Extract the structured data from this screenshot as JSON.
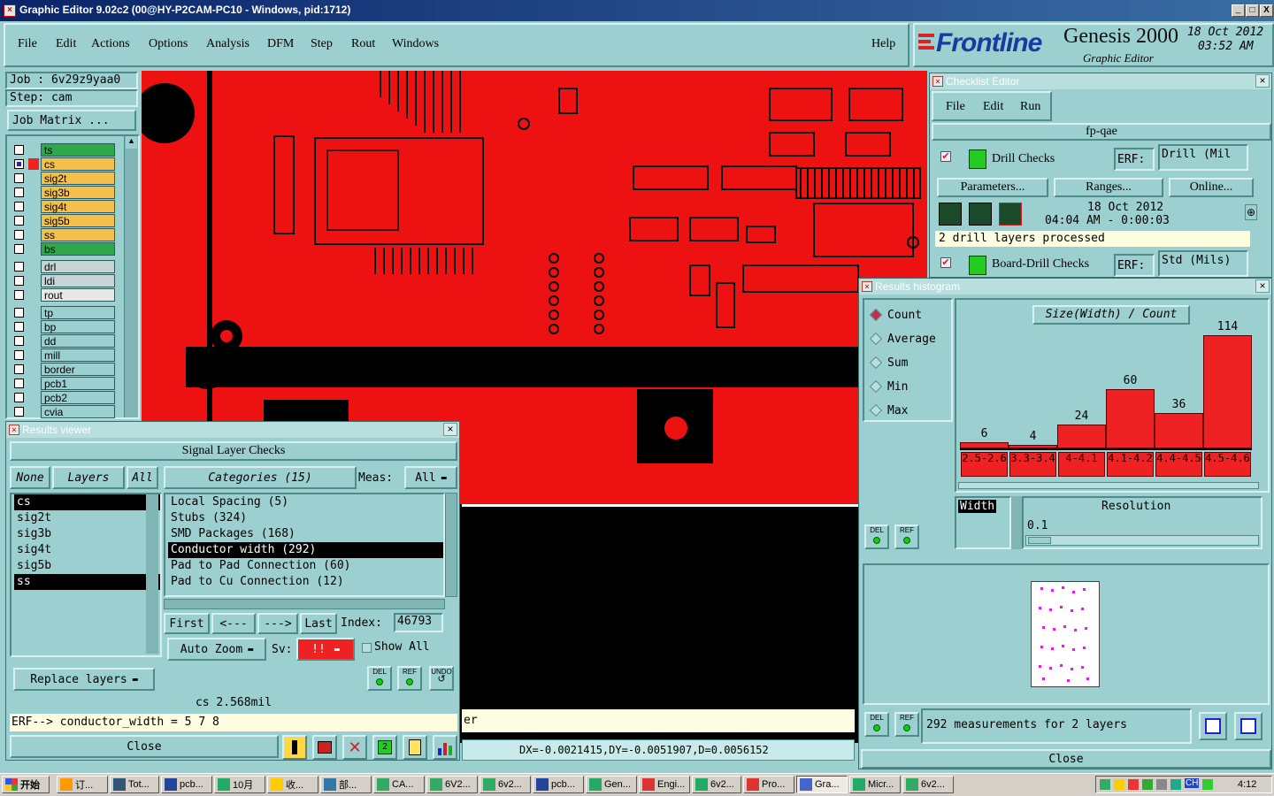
{
  "window": {
    "title": "Graphic Editor 9.02c2 (00@HY-P2CAM-PC10 - Windows, pid:1712)",
    "controls": [
      "_",
      "□",
      "X"
    ]
  },
  "menu": {
    "items": [
      "File",
      "Edit",
      "Actions",
      "Options",
      "Analysis",
      "DFM",
      "Step",
      "Rout",
      "Windows"
    ],
    "help": "Help"
  },
  "branding": {
    "logo": "Frontline",
    "product": "Genesis 2000",
    "subtitle": "Graphic Editor",
    "date": "18 Oct 2012",
    "time": "03:52 AM"
  },
  "job": {
    "job_label": "Job : 6v29z9yaa0",
    "step_label": "Step: cam",
    "matrix_button": "Job Matrix ..."
  },
  "layers": {
    "group1": [
      {
        "name": "ts",
        "color": "#2fa84a"
      },
      {
        "name": "cs",
        "color": "#f5c04a",
        "active": true
      },
      {
        "name": "sig2t",
        "color": "#f5c04a"
      },
      {
        "name": "sig3b",
        "color": "#f5c04a"
      },
      {
        "name": "sig4t",
        "color": "#f5c04a"
      },
      {
        "name": "sig5b",
        "color": "#f5c04a"
      },
      {
        "name": "ss",
        "color": "#f5c04a"
      },
      {
        "name": "bs",
        "color": "#2fa84a"
      }
    ],
    "group2": [
      {
        "name": "drl",
        "color": "#c8d4d4"
      },
      {
        "name": "ldi",
        "color": "#c8d4d4"
      },
      {
        "name": "rout",
        "color": "#e8e8e8"
      }
    ],
    "group3": [
      {
        "name": "tp"
      },
      {
        "name": "bp"
      },
      {
        "name": "dd"
      },
      {
        "name": "mill"
      },
      {
        "name": "border"
      },
      {
        "name": "pcb1"
      },
      {
        "name": "pcb2"
      },
      {
        "name": "cvia"
      }
    ]
  },
  "results_viewer": {
    "title": "Results viewer",
    "header": "Signal Layer Checks",
    "none_btn": "None",
    "layers_btn": "Layers",
    "all_btn": "All",
    "categories_btn": "Categories (15)",
    "meas_label": "Meas:",
    "meas_value": "All",
    "layer_list": [
      "cs",
      "sig2t",
      "sig3b",
      "sig4t",
      "sig5b",
      "ss"
    ],
    "categories": [
      "Local Spacing (5)",
      "Stubs (324)",
      "SMD Packages (168)",
      "Conductor width (292)",
      "Pad to Pad Connection (60)",
      "Pad to Cu Connection (12)"
    ],
    "first_btn": "First",
    "prev_btn": "<---",
    "next_btn": "--->",
    "last_btn": "Last",
    "index_label": "Index:",
    "index_value": "46793",
    "zoom_btn": "Auto Zoom",
    "sv_label": "Sv:",
    "sv_value": "!!",
    "show_all": "Show All",
    "replace_btn": "Replace layers",
    "del_label": "DEL",
    "ref_label": "REF",
    "undo_label": "UNDO",
    "status_line": "cs 2.568mil",
    "erf_line": "ERF--> conductor_width = 5 7 8",
    "close_btn": "Close"
  },
  "canvas": {
    "coords": "DX=-0.0021415,DY=-0.0051907,D=0.0056152",
    "status_tail": "er"
  },
  "checklist": {
    "title": "Checklist Editor",
    "menu": [
      "File",
      "Edit",
      "Run"
    ],
    "name": "fp-qae",
    "check1": "Drill Checks",
    "erf_label": "ERF:",
    "erf1": "Drill (Mil",
    "params_btn": "Parameters...",
    "ranges_btn": "Ranges...",
    "online_btn": "Online...",
    "run_date": "18 Oct 2012",
    "run_time": "04:04 AM - 0:00:03",
    "status": "2 drill layers processed",
    "check2": "Board-Drill Checks",
    "erf2": "Std (Mils)"
  },
  "histogram": {
    "title": "Results histogram",
    "options": [
      "Count",
      "Average",
      "Sum",
      "Min",
      "Max"
    ],
    "selected": "Count",
    "chart_title": "Size(Width) / Count",
    "axis_label": "Width",
    "resolution_label": "Resolution",
    "resolution_value": "0.1",
    "del_label": "DEL",
    "ref_label": "REF",
    "measure_text": "292 measurements for 2 layers",
    "close_btn": "Close",
    "bar_color": "#ee2222"
  },
  "chart_data": {
    "type": "bar",
    "categories": [
      "2.5-2.6",
      "3.3-3.4",
      "4-4.1",
      "4.1-4.2",
      "4.4-4.5",
      "4.5-4.6"
    ],
    "values": [
      6,
      4,
      24,
      60,
      36,
      114
    ],
    "title": "Size(Width) / Count",
    "xlabel": "Width",
    "ylabel": "",
    "ylim": [
      0,
      130
    ]
  },
  "taskbar": {
    "start": "开始",
    "items": [
      "订...",
      "Tot...",
      "pcb...",
      "10月",
      "收...",
      "部...",
      "CA...",
      "6V2...",
      "6v2...",
      "pcb...",
      "Gen...",
      "Engi...",
      "6v2...",
      "Pro...",
      "Gra...",
      "Micr...",
      "6v2..."
    ],
    "tray_lang": "CH",
    "clock": "4:12"
  }
}
